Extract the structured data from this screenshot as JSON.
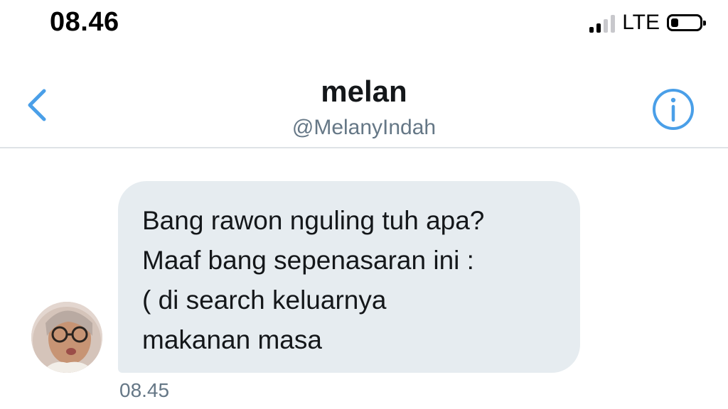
{
  "status_bar": {
    "time": "08.46",
    "network": "LTE",
    "icons": [
      "signal-icon",
      "battery-icon"
    ]
  },
  "header": {
    "name": "melan",
    "handle": "@MelanyIndah",
    "icons": [
      "back-chevron-icon",
      "info-icon"
    ],
    "accent_color": "#4a9fe8"
  },
  "message": {
    "lines": [
      "Bang rawon nguling tuh apa?",
      "Maaf bang sepenasaran ini :",
      "( di search keluarnya",
      "makanan masa"
    ],
    "timestamp": "08.45",
    "bubble_color": "#e6ecf0"
  }
}
